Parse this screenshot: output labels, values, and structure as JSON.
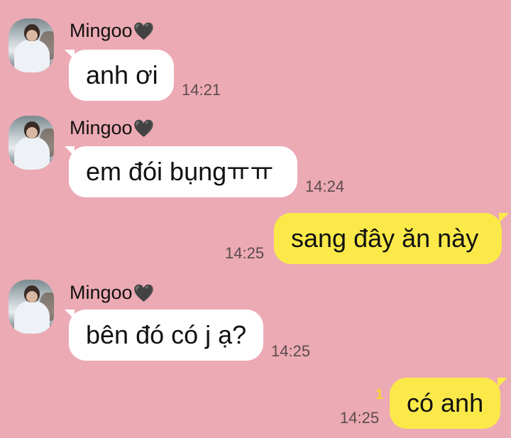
{
  "messages": [
    {
      "direction": "in",
      "sender": "Mingoo",
      "sender_emoji": "🖤",
      "text": "anh ơi",
      "time": "14:21"
    },
    {
      "direction": "in",
      "sender": "Mingoo",
      "sender_emoji": "🖤",
      "text": "em đói bụngㅠㅠ",
      "time": "14:24"
    },
    {
      "direction": "out",
      "text": "sang đây ăn này",
      "time": "14:25"
    },
    {
      "direction": "in",
      "sender": "Mingoo",
      "sender_emoji": "🖤",
      "text": "bên đó có j ạ?",
      "time": "14:25"
    },
    {
      "direction": "out",
      "text": "có anh",
      "time": "14:25",
      "unread": "1"
    }
  ],
  "colors": {
    "background": "#ecaab4",
    "incoming_bubble": "#ffffff",
    "outgoing_bubble": "#fbe949",
    "unread": "#f7d237"
  }
}
